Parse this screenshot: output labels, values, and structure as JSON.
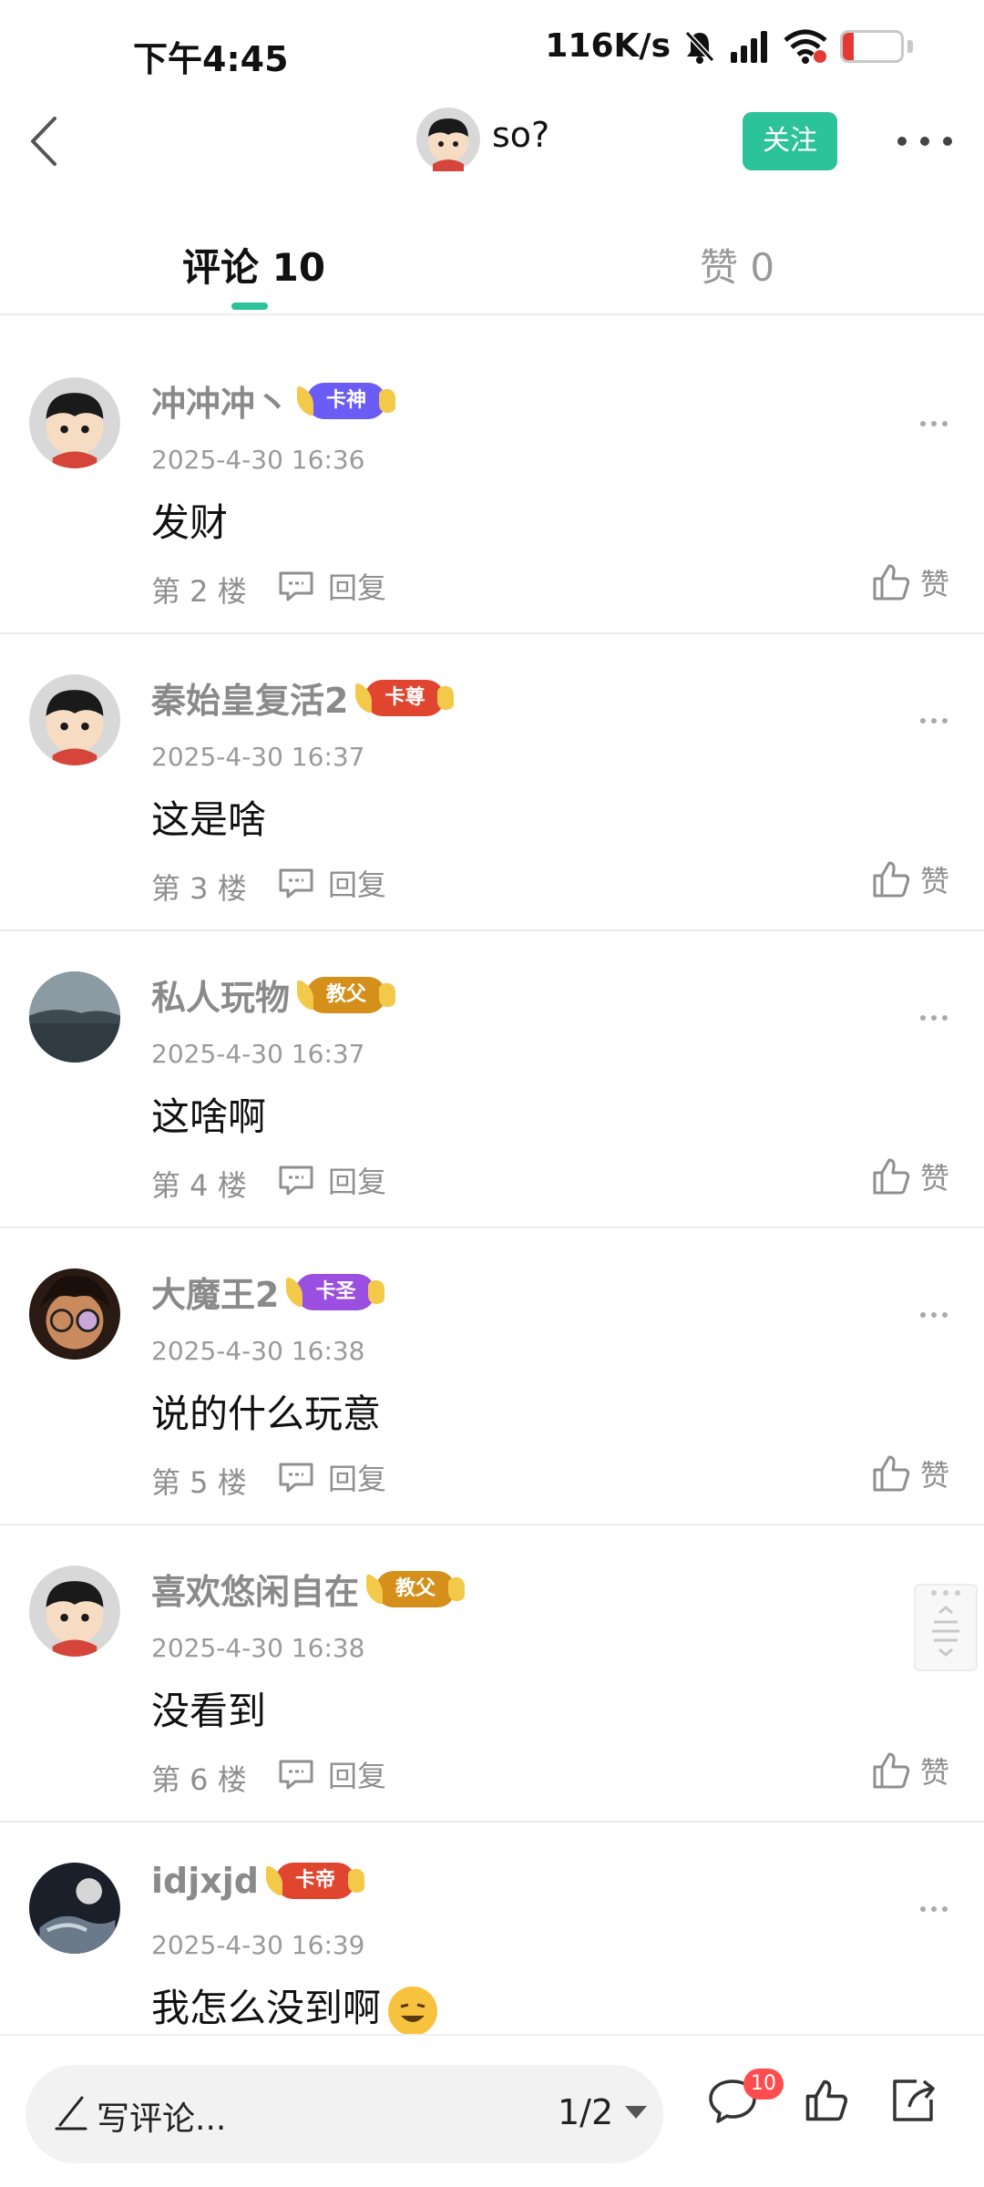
{
  "status_bar": {
    "time": "下午4:45",
    "net_speed": "116K/s",
    "battery": "18",
    "battery_level": 0.18
  },
  "header": {
    "username": "so?",
    "follow_label": "关注"
  },
  "tabs": [
    {
      "label": "评论 10",
      "active": true
    },
    {
      "label": "赞 0",
      "active": false
    }
  ],
  "comments": [
    {
      "user": "冲冲冲丶",
      "badge": "卡神",
      "badge_color": "#6b5cf5",
      "date": "2025-4-30 16:36",
      "text": "发财",
      "floor": "第 2 楼",
      "reply": "回复",
      "like": "赞"
    },
    {
      "user": "秦始皇复活2",
      "badge": "卡尊",
      "badge_color": "#e0452f",
      "date": "2025-4-30 16:37",
      "text": "这是啥",
      "floor": "第 3 楼",
      "reply": "回复",
      "like": "赞"
    },
    {
      "user": "私人玩物",
      "badge": "教父",
      "badge_color": "#d4901a",
      "date": "2025-4-30 16:37",
      "text": "这啥啊",
      "floor": "第 4 楼",
      "reply": "回复",
      "like": "赞"
    },
    {
      "user": "大魔王2",
      "badge": "卡圣",
      "badge_color": "#9b4fe0",
      "date": "2025-4-30 16:38",
      "text": "说的什么玩意",
      "floor": "第 5 楼",
      "reply": "回复",
      "like": "赞"
    },
    {
      "user": "喜欢悠闲自在",
      "badge": "教父",
      "badge_color": "#d4901a",
      "date": "2025-4-30 16:38",
      "text": "没看到",
      "floor": "第 6 楼",
      "reply": "回复",
      "like": "赞"
    },
    {
      "user": "idjxjd",
      "badge": "卡帝",
      "badge_color": "#e0452f",
      "date": "2025-4-30 16:39",
      "text": "我怎么没到啊",
      "floor": "",
      "reply": "",
      "like": ""
    }
  ],
  "bottom_bar": {
    "placeholder": "写评论...",
    "page": "1/2",
    "comment_count": "10"
  },
  "colors": {
    "accent": "#2dc39a",
    "badge_red": "#ff4d4f"
  }
}
